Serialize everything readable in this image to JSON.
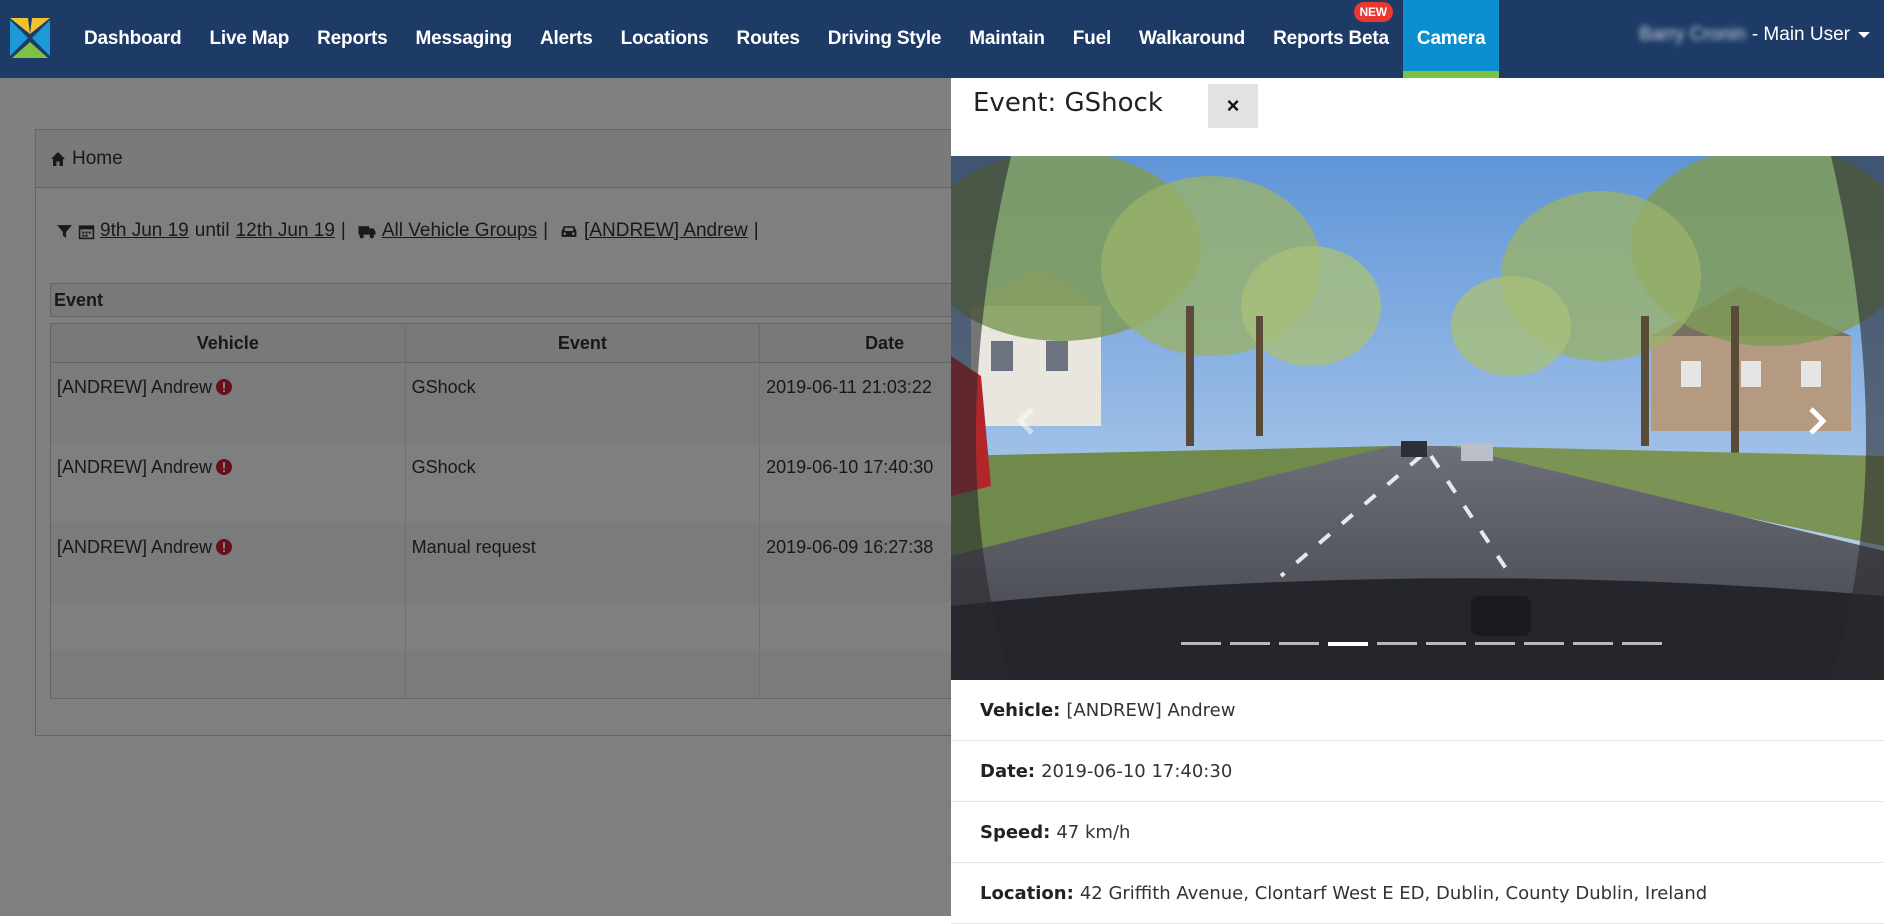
{
  "nav": {
    "items": [
      {
        "label": "Dashboard"
      },
      {
        "label": "Live Map"
      },
      {
        "label": "Reports"
      },
      {
        "label": "Messaging"
      },
      {
        "label": "Alerts"
      },
      {
        "label": "Locations"
      },
      {
        "label": "Routes"
      },
      {
        "label": "Driving Style"
      },
      {
        "label": "Maintain"
      },
      {
        "label": "Fuel"
      },
      {
        "label": "Walkaround"
      },
      {
        "label": "Reports Beta",
        "badge": "NEW"
      },
      {
        "label": "Camera",
        "active": true
      }
    ],
    "user_name": "Barry Cronin",
    "user_role": "- Main User"
  },
  "breadcrumb": {
    "label": "Home"
  },
  "filter": {
    "start": "9th Jun 19",
    "until": "until",
    "end": "12th Jun 19",
    "groups": "All Vehicle Groups",
    "vehicle": "[ANDREW] Andrew",
    "sep": "|"
  },
  "events_table": {
    "title": "Event",
    "headers": [
      "Vehicle",
      "Event",
      "Date"
    ],
    "rows": [
      {
        "vehicle": "[ANDREW] Andrew",
        "event": "GShock",
        "date": "2019-06-11 21:03:22"
      },
      {
        "vehicle": "[ANDREW] Andrew",
        "event": "GShock",
        "date": "2019-06-10 17:40:30"
      },
      {
        "vehicle": "[ANDREW] Andrew",
        "event": "Manual request",
        "date": "2019-06-09 16:27:38"
      }
    ]
  },
  "panel": {
    "title": "Event: GShock",
    "close_label": "×",
    "slide_count": 10,
    "active_slide": 4,
    "details": [
      {
        "label": "Vehicle:",
        "value": "[ANDREW] Andrew"
      },
      {
        "label": "Date:",
        "value": "2019-06-10 17:40:30"
      },
      {
        "label": "Speed:",
        "value": "47 km/h"
      },
      {
        "label": "Location:",
        "value": "42 Griffith Avenue, Clontarf West E ED, Dublin, County Dublin, Ireland"
      }
    ]
  },
  "colors": {
    "nav_bg": "#1e3a66",
    "nav_active": "#0c8fd0",
    "nav_active_bar": "#7dc242",
    "badge": "#e8382f",
    "alert": "#d0202a"
  }
}
